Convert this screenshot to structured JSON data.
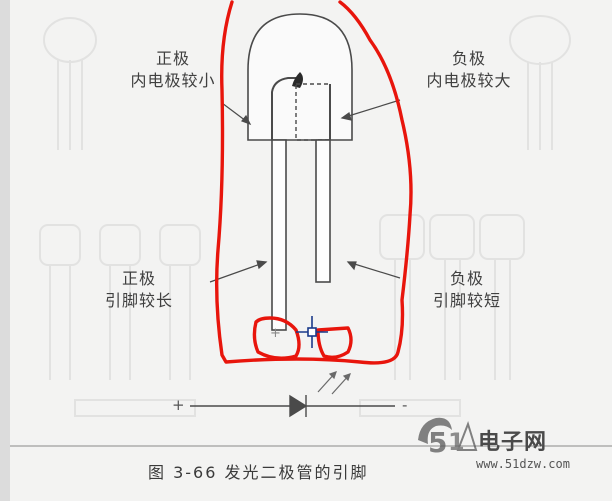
{
  "labels": {
    "pos_electrode": {
      "line1": "正极",
      "line2": "内电极较小"
    },
    "neg_electrode": {
      "line1": "负极",
      "line2": "内电极较大"
    },
    "pos_lead": {
      "line1": "正极",
      "line2": "引脚较长"
    },
    "neg_lead": {
      "line1": "负极",
      "line2": "引脚较短"
    },
    "pad_plus": "+"
  },
  "symbol": {
    "plus": "+",
    "minus": "-"
  },
  "caption": "图 3-66   发光二极管的引脚",
  "watermark": {
    "brand": "电子网",
    "url": "www.51dzw.com"
  },
  "colors": {
    "annotation": "#e8150c",
    "line": "#4a4a4a",
    "cursor": "#1a3a8a"
  }
}
